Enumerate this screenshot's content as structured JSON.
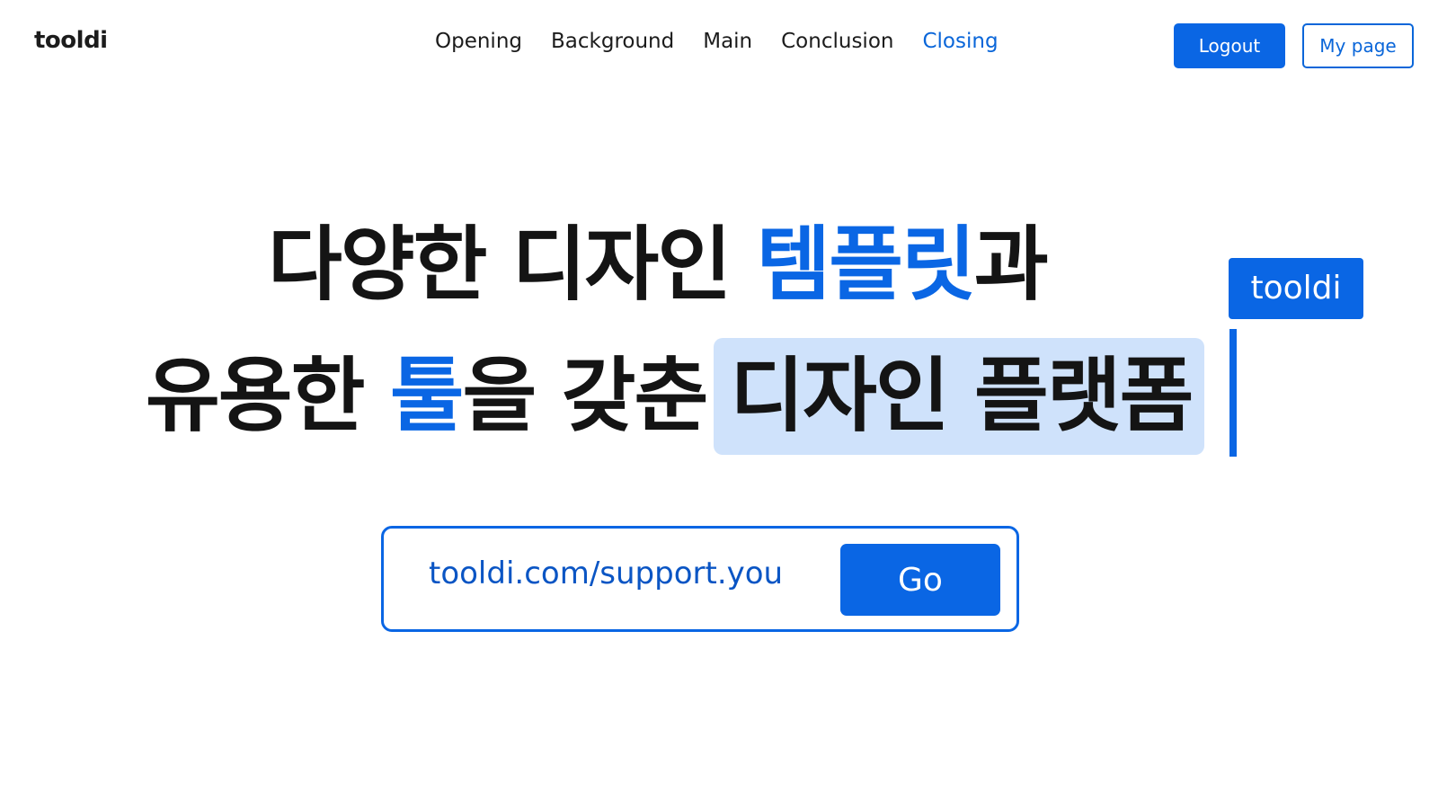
{
  "header": {
    "logo": "tooldi",
    "nav": [
      {
        "label": "Opening",
        "active": false
      },
      {
        "label": "Background",
        "active": false
      },
      {
        "label": "Main",
        "active": false
      },
      {
        "label": "Conclusion",
        "active": false
      },
      {
        "label": "Closing",
        "active": true
      }
    ],
    "logout_label": "Logout",
    "mypage_label": "My page"
  },
  "hero": {
    "line1": {
      "part1": "다양한 디자인 ",
      "accent": "템플릿",
      "part2": "과"
    },
    "line2": {
      "part1": "유용한 ",
      "accent": "툴",
      "part2": "을 갖춘",
      "highlight": "디자인 플랫폼"
    },
    "cursor_tag": "tooldi"
  },
  "url_bar": {
    "value": "tooldi.com/support.you",
    "go_label": "Go"
  },
  "colors": {
    "accent": "#0a66e4",
    "highlight_bg": "#cfe2fb",
    "text": "#141414"
  }
}
